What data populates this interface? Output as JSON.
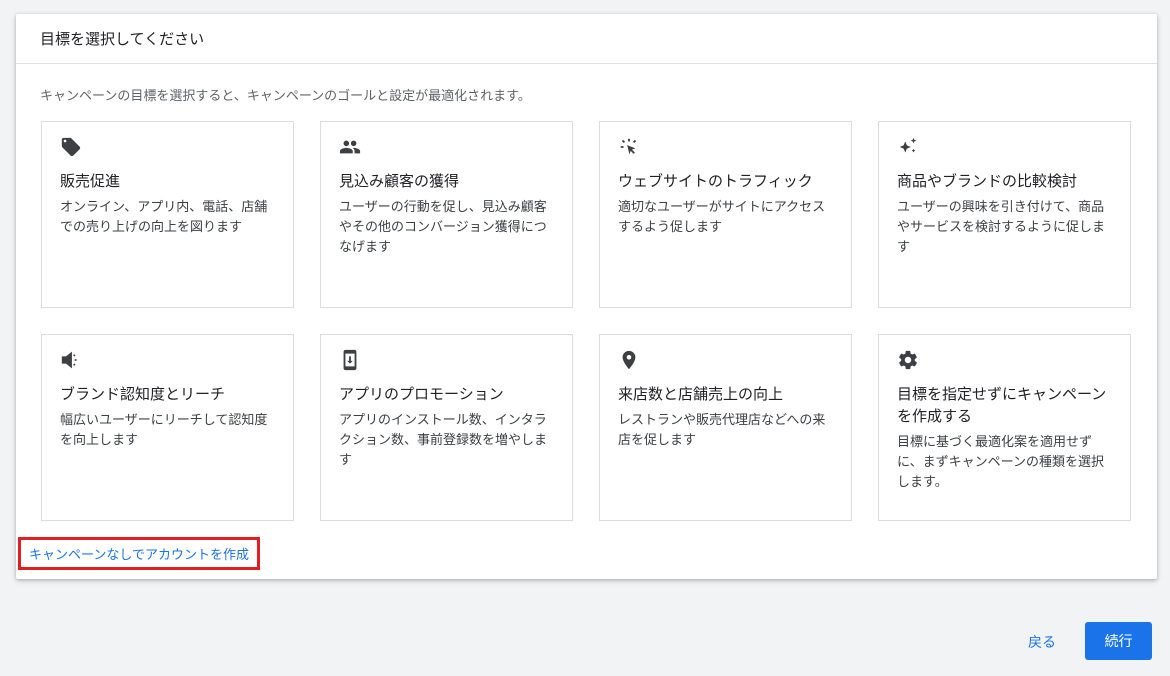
{
  "dialog": {
    "title": "目標を選択してください",
    "intro": "キャンペーンの目標を選択すると、キャンペーンのゴールと設定が最適化されます。"
  },
  "goals": [
    {
      "icon": "tag-icon",
      "title": "販売促進",
      "desc": "オンライン、アプリ内、電話、店舗での売り上げの向上を図ります"
    },
    {
      "icon": "people-icon",
      "title": "見込み顧客の獲得",
      "desc": "ユーザーの行動を促し、見込み顧客やその他のコンバージョン獲得につなげます"
    },
    {
      "icon": "cursor-click-icon",
      "title": "ウェブサイトのトラフィック",
      "desc": "適切なユーザーがサイトにアクセスするよう促します"
    },
    {
      "icon": "sparkle-icon",
      "title": "商品やブランドの比較検討",
      "desc": "ユーザーの興味を引き付けて、商品やサービスを検討するように促します"
    },
    {
      "icon": "megaphone-icon",
      "title": "ブランド認知度とリーチ",
      "desc": "幅広いユーザーにリーチして認知度を向上します"
    },
    {
      "icon": "mobile-download-icon",
      "title": "アプリのプロモーション",
      "desc": "アプリのインストール数、インタラクション数、事前登録数を増やします"
    },
    {
      "icon": "location-pin-icon",
      "title": "来店数と店舗売上の向上",
      "desc": "レストランや販売代理店などへの来店を促します"
    },
    {
      "icon": "gear-icon",
      "title": "目標を指定せずにキャンペーンを作成する",
      "desc": "目標に基づく最適化案を適用せずに、まずキャンペーンの種類を選択します。"
    }
  ],
  "no_campaign_link": "キャンペーンなしでアカウントを作成",
  "footer": {
    "back_label": "戻る",
    "continue_label": "続行"
  }
}
